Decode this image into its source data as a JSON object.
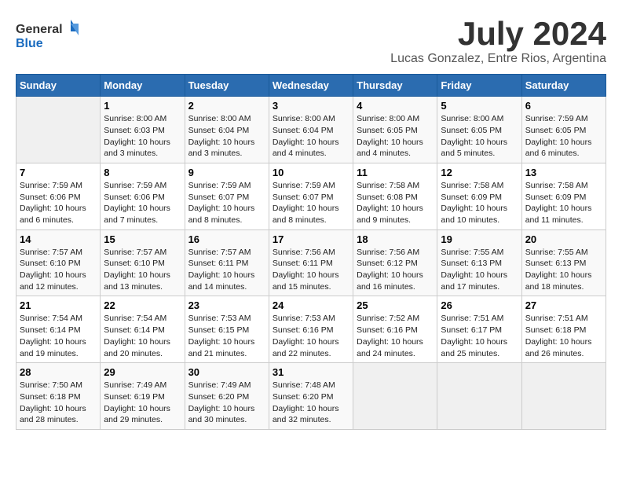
{
  "header": {
    "logo_general": "General",
    "logo_blue": "Blue",
    "month_title": "July 2024",
    "location": "Lucas Gonzalez, Entre Rios, Argentina"
  },
  "days_of_week": [
    "Sunday",
    "Monday",
    "Tuesday",
    "Wednesday",
    "Thursday",
    "Friday",
    "Saturday"
  ],
  "weeks": [
    [
      {
        "day": null
      },
      {
        "day": 1,
        "sunrise": "Sunrise: 8:00 AM",
        "sunset": "Sunset: 6:03 PM",
        "daylight": "Daylight: 10 hours and 3 minutes."
      },
      {
        "day": 2,
        "sunrise": "Sunrise: 8:00 AM",
        "sunset": "Sunset: 6:04 PM",
        "daylight": "Daylight: 10 hours and 3 minutes."
      },
      {
        "day": 3,
        "sunrise": "Sunrise: 8:00 AM",
        "sunset": "Sunset: 6:04 PM",
        "daylight": "Daylight: 10 hours and 4 minutes."
      },
      {
        "day": 4,
        "sunrise": "Sunrise: 8:00 AM",
        "sunset": "Sunset: 6:05 PM",
        "daylight": "Daylight: 10 hours and 4 minutes."
      },
      {
        "day": 5,
        "sunrise": "Sunrise: 8:00 AM",
        "sunset": "Sunset: 6:05 PM",
        "daylight": "Daylight: 10 hours and 5 minutes."
      },
      {
        "day": 6,
        "sunrise": "Sunrise: 7:59 AM",
        "sunset": "Sunset: 6:05 PM",
        "daylight": "Daylight: 10 hours and 6 minutes."
      }
    ],
    [
      {
        "day": 7,
        "sunrise": "Sunrise: 7:59 AM",
        "sunset": "Sunset: 6:06 PM",
        "daylight": "Daylight: 10 hours and 6 minutes."
      },
      {
        "day": 8,
        "sunrise": "Sunrise: 7:59 AM",
        "sunset": "Sunset: 6:06 PM",
        "daylight": "Daylight: 10 hours and 7 minutes."
      },
      {
        "day": 9,
        "sunrise": "Sunrise: 7:59 AM",
        "sunset": "Sunset: 6:07 PM",
        "daylight": "Daylight: 10 hours and 8 minutes."
      },
      {
        "day": 10,
        "sunrise": "Sunrise: 7:59 AM",
        "sunset": "Sunset: 6:07 PM",
        "daylight": "Daylight: 10 hours and 8 minutes."
      },
      {
        "day": 11,
        "sunrise": "Sunrise: 7:58 AM",
        "sunset": "Sunset: 6:08 PM",
        "daylight": "Daylight: 10 hours and 9 minutes."
      },
      {
        "day": 12,
        "sunrise": "Sunrise: 7:58 AM",
        "sunset": "Sunset: 6:09 PM",
        "daylight": "Daylight: 10 hours and 10 minutes."
      },
      {
        "day": 13,
        "sunrise": "Sunrise: 7:58 AM",
        "sunset": "Sunset: 6:09 PM",
        "daylight": "Daylight: 10 hours and 11 minutes."
      }
    ],
    [
      {
        "day": 14,
        "sunrise": "Sunrise: 7:57 AM",
        "sunset": "Sunset: 6:10 PM",
        "daylight": "Daylight: 10 hours and 12 minutes."
      },
      {
        "day": 15,
        "sunrise": "Sunrise: 7:57 AM",
        "sunset": "Sunset: 6:10 PM",
        "daylight": "Daylight: 10 hours and 13 minutes."
      },
      {
        "day": 16,
        "sunrise": "Sunrise: 7:57 AM",
        "sunset": "Sunset: 6:11 PM",
        "daylight": "Daylight: 10 hours and 14 minutes."
      },
      {
        "day": 17,
        "sunrise": "Sunrise: 7:56 AM",
        "sunset": "Sunset: 6:11 PM",
        "daylight": "Daylight: 10 hours and 15 minutes."
      },
      {
        "day": 18,
        "sunrise": "Sunrise: 7:56 AM",
        "sunset": "Sunset: 6:12 PM",
        "daylight": "Daylight: 10 hours and 16 minutes."
      },
      {
        "day": 19,
        "sunrise": "Sunrise: 7:55 AM",
        "sunset": "Sunset: 6:13 PM",
        "daylight": "Daylight: 10 hours and 17 minutes."
      },
      {
        "day": 20,
        "sunrise": "Sunrise: 7:55 AM",
        "sunset": "Sunset: 6:13 PM",
        "daylight": "Daylight: 10 hours and 18 minutes."
      }
    ],
    [
      {
        "day": 21,
        "sunrise": "Sunrise: 7:54 AM",
        "sunset": "Sunset: 6:14 PM",
        "daylight": "Daylight: 10 hours and 19 minutes."
      },
      {
        "day": 22,
        "sunrise": "Sunrise: 7:54 AM",
        "sunset": "Sunset: 6:14 PM",
        "daylight": "Daylight: 10 hours and 20 minutes."
      },
      {
        "day": 23,
        "sunrise": "Sunrise: 7:53 AM",
        "sunset": "Sunset: 6:15 PM",
        "daylight": "Daylight: 10 hours and 21 minutes."
      },
      {
        "day": 24,
        "sunrise": "Sunrise: 7:53 AM",
        "sunset": "Sunset: 6:16 PM",
        "daylight": "Daylight: 10 hours and 22 minutes."
      },
      {
        "day": 25,
        "sunrise": "Sunrise: 7:52 AM",
        "sunset": "Sunset: 6:16 PM",
        "daylight": "Daylight: 10 hours and 24 minutes."
      },
      {
        "day": 26,
        "sunrise": "Sunrise: 7:51 AM",
        "sunset": "Sunset: 6:17 PM",
        "daylight": "Daylight: 10 hours and 25 minutes."
      },
      {
        "day": 27,
        "sunrise": "Sunrise: 7:51 AM",
        "sunset": "Sunset: 6:18 PM",
        "daylight": "Daylight: 10 hours and 26 minutes."
      }
    ],
    [
      {
        "day": 28,
        "sunrise": "Sunrise: 7:50 AM",
        "sunset": "Sunset: 6:18 PM",
        "daylight": "Daylight: 10 hours and 28 minutes."
      },
      {
        "day": 29,
        "sunrise": "Sunrise: 7:49 AM",
        "sunset": "Sunset: 6:19 PM",
        "daylight": "Daylight: 10 hours and 29 minutes."
      },
      {
        "day": 30,
        "sunrise": "Sunrise: 7:49 AM",
        "sunset": "Sunset: 6:20 PM",
        "daylight": "Daylight: 10 hours and 30 minutes."
      },
      {
        "day": 31,
        "sunrise": "Sunrise: 7:48 AM",
        "sunset": "Sunset: 6:20 PM",
        "daylight": "Daylight: 10 hours and 32 minutes."
      },
      {
        "day": null
      },
      {
        "day": null
      },
      {
        "day": null
      }
    ]
  ]
}
